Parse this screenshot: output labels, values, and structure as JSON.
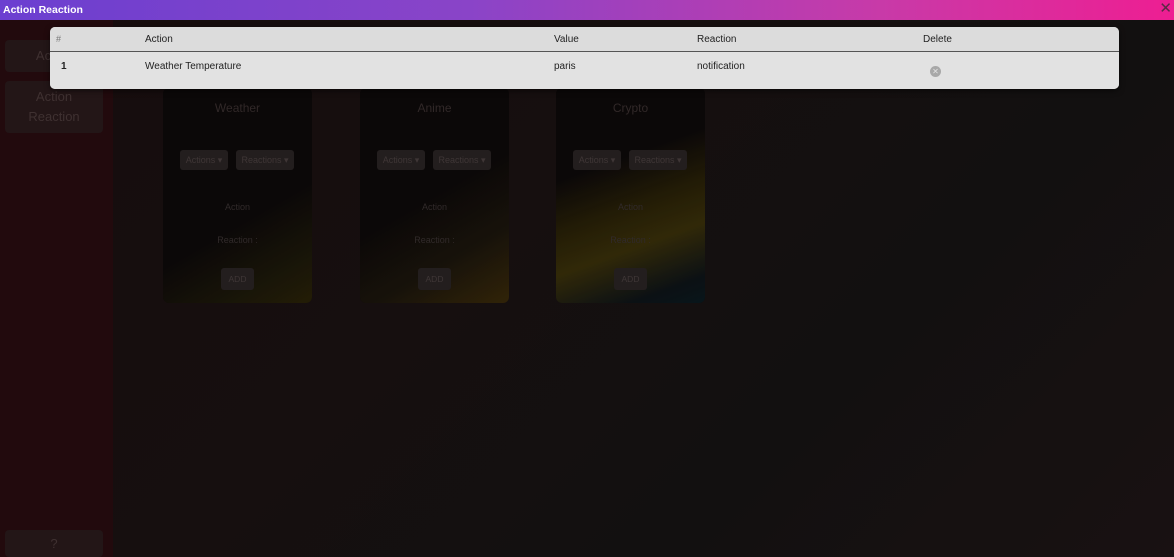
{
  "window": {
    "title": "Action Reaction",
    "close_icon": "close-icon"
  },
  "sidebar": {
    "items": [
      {
        "label": "Action"
      },
      {
        "label_line1": "Action",
        "label_line2": "Reaction"
      },
      {
        "label": "?"
      }
    ]
  },
  "cards": [
    {
      "title": "Weather",
      "actions_label": "Actions ▾",
      "reactions_label": "Reactions ▾",
      "action_text": "Action",
      "reaction_text": "Reaction :",
      "add_label": "ADD"
    },
    {
      "title": "Anime",
      "actions_label": "Actions ▾",
      "reactions_label": "Reactions ▾",
      "action_text": "Action",
      "reaction_text": "Reaction :",
      "add_label": "ADD"
    },
    {
      "title": "Crypto",
      "actions_label": "Actions ▾",
      "reactions_label": "Reactions ▾",
      "action_text": "Action",
      "reaction_text": "Reaction :",
      "add_label": "ADD"
    }
  ],
  "table": {
    "headers": {
      "num": "#",
      "action": "Action",
      "value": "Value",
      "reaction": "Reaction",
      "delete": "Delete"
    },
    "rows": [
      {
        "num": "1",
        "action": "Weather Temperature",
        "value": "paris",
        "reaction": "notification",
        "delete_icon": "delete-circle-icon"
      }
    ]
  },
  "colors": {
    "titlebar_start": "#6b3fd0",
    "titlebar_end": "#ee1e92",
    "modal_bg": "#d9d9d9"
  }
}
